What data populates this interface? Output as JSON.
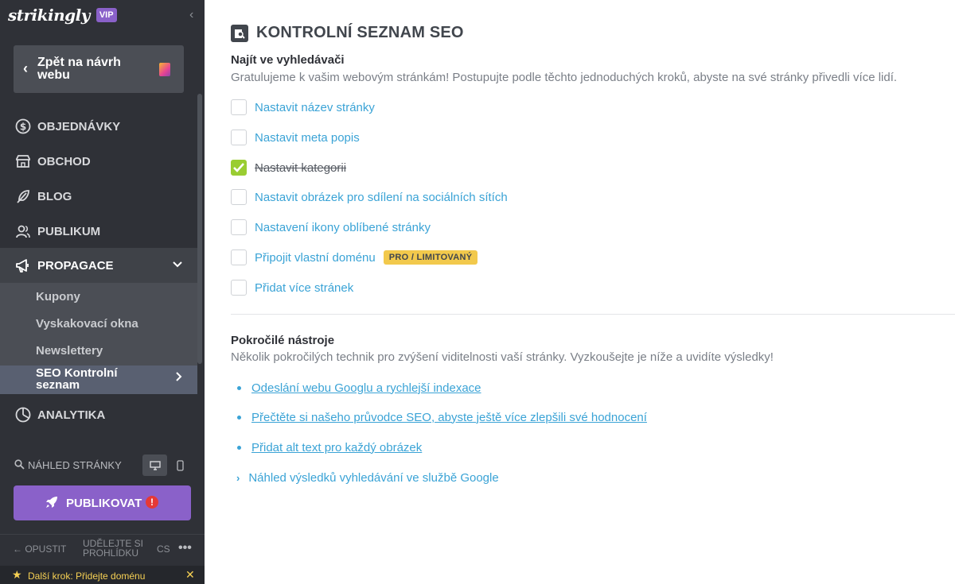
{
  "sidebar": {
    "logo": "strikingly",
    "vip": "VIP",
    "back_label": "Zpět na návrh webu",
    "nav": [
      {
        "label": "OBJEDNÁVKY",
        "icon": "dollar-circle-icon"
      },
      {
        "label": "OBCHOD",
        "icon": "store-icon"
      },
      {
        "label": "BLOG",
        "icon": "feather-icon"
      },
      {
        "label": "PUBLIKUM",
        "icon": "users-icon"
      },
      {
        "label": "PROPAGACE",
        "icon": "megaphone-icon"
      },
      {
        "label": "ANALYTIKA",
        "icon": "analytics-icon"
      }
    ],
    "submenu": [
      "Kupony",
      "Vyskakovací okna",
      "Newslettery",
      "SEO Kontrolní seznam"
    ],
    "preview_label": "NÁHLED STRÁNKY",
    "publish_label": "PUBLIKOVAT",
    "warning_mark": "!",
    "exit_label": "OPUSTIT",
    "tour_label": "UDĚLEJTE SI PROHLÍDKU",
    "lang": "CS",
    "more": "•••",
    "next_step": "Další krok: Přidejte doménu"
  },
  "main": {
    "title": "KONTROLNÍ SEZNAM SEO",
    "section1": {
      "title": "Najít ve vyhledávači",
      "desc": "Gratulujeme k vašim webovým stránkám! Postupujte podle těchto jednoduchých kroků, abyste na své stránky přivedli více lidí.",
      "items": [
        {
          "label": "Nastavit název stránky",
          "checked": false
        },
        {
          "label": "Nastavit meta popis",
          "checked": false
        },
        {
          "label": "Nastavit kategorii",
          "checked": true
        },
        {
          "label": "Nastavit obrázek pro sdílení na sociálních sítích",
          "checked": false
        },
        {
          "label": "Nastavení ikony oblíbené stránky",
          "checked": false
        },
        {
          "label": "Připojit vlastní doménu",
          "checked": false,
          "tag": "PRO / LIMITOVANÝ"
        },
        {
          "label": "Přidat více stránek",
          "checked": false
        }
      ]
    },
    "section2": {
      "title": "Pokročilé nástroje",
      "desc": "Několik pokročilých technik pro zvýšení viditelnosti vaší stránky. Vyzkoušejte je níže a uvidíte výsledky!",
      "links": [
        "Odeslání webu Googlu a rychlejší indexace",
        "Přečtěte si našeho průvodce SEO, abyste ještě více zlepšili své hodnocení",
        "Přidat alt text pro každý obrázek"
      ],
      "expand": "Náhled výsledků vyhledávání ve službě Google"
    }
  },
  "colors": {
    "sidebar": "#2f3137",
    "accent": "#8a61c9",
    "link": "#3aa3d6",
    "check": "#9acd32",
    "pro_tag": "#f2c94c"
  }
}
